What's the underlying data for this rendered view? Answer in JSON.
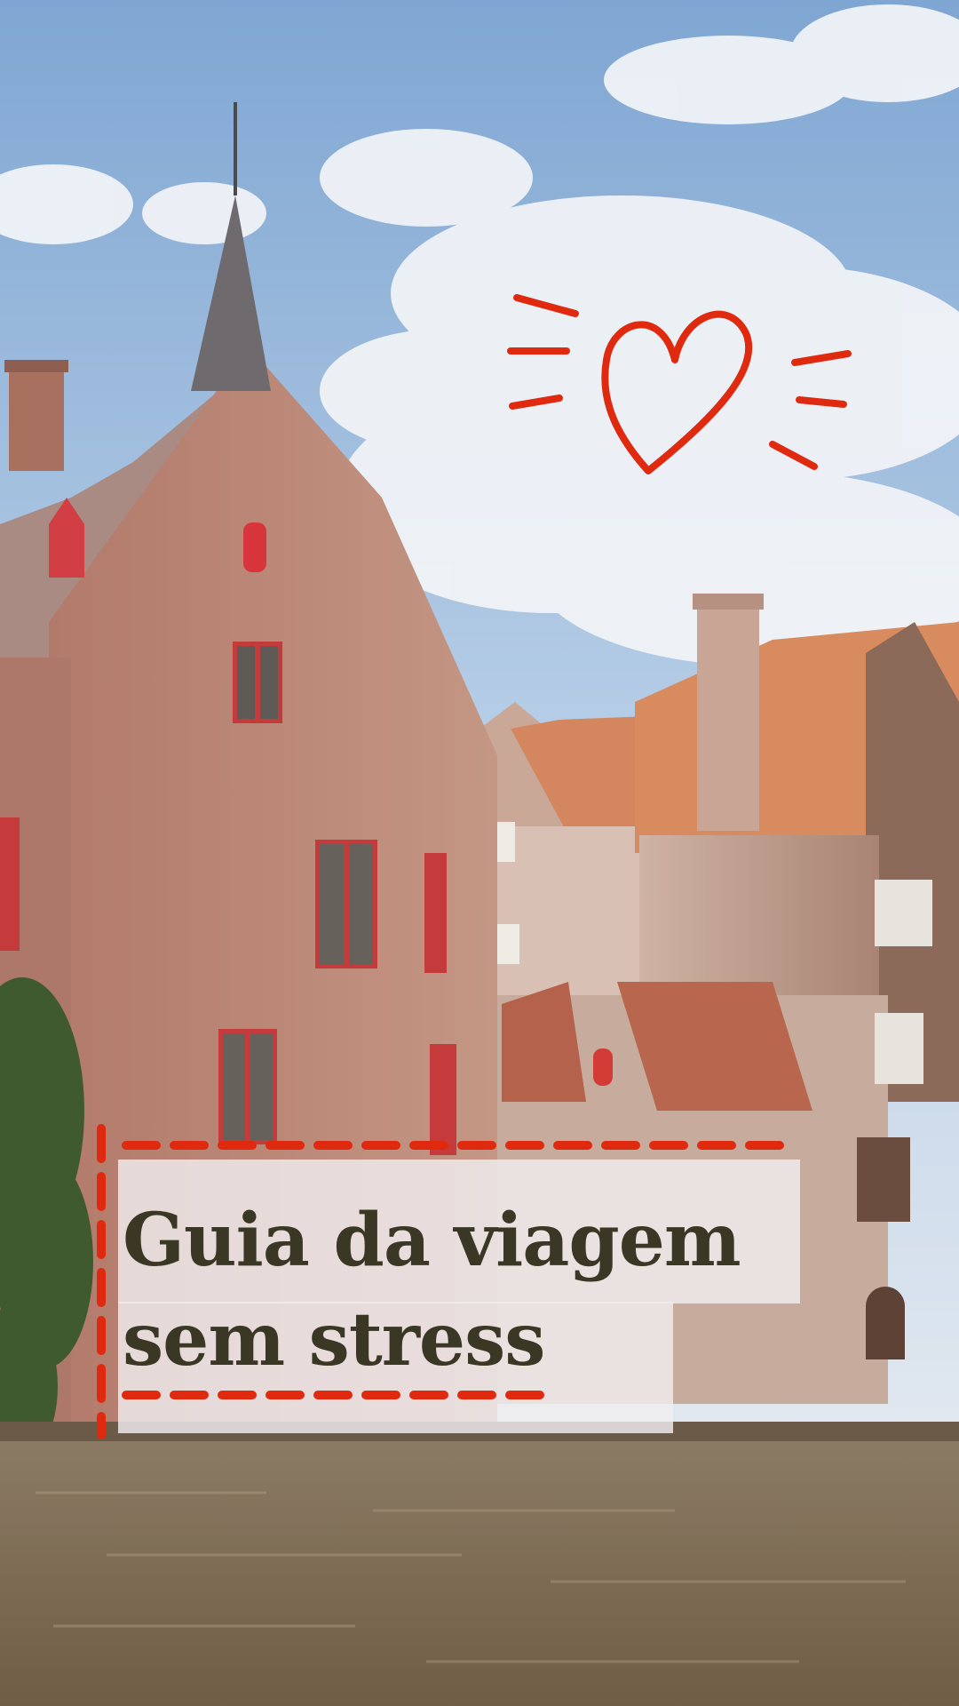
{
  "title": {
    "line1": "Guia da viagem",
    "line2": "sem stress"
  },
  "colors": {
    "accent": "#e02a10",
    "title_text": "#3b3725",
    "panel": "#f0eef0",
    "sky": "#8fb3d8",
    "water": "#7b6a52",
    "brick": "#b47a68",
    "roof": "#d4865e"
  },
  "decorations": {
    "heart": "heart-doodle-icon",
    "frame": "dashed-frame"
  }
}
